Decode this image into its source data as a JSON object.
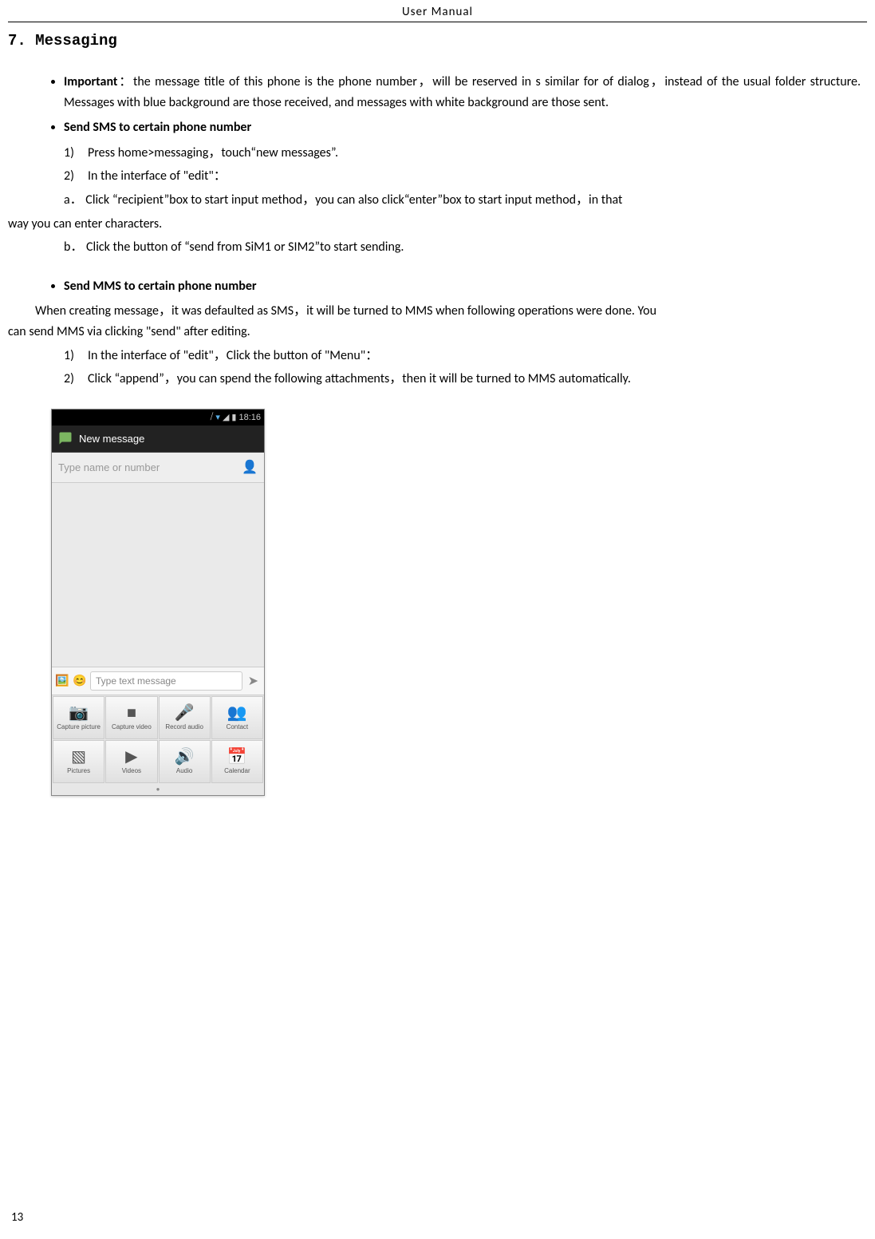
{
  "header": {
    "title": "User    Manual"
  },
  "section": {
    "title": "7. Messaging"
  },
  "bullets": {
    "important_label": "Important",
    "important_text": "：the message title of this phone is the phone number，will be reserved in s similar for of dialog，instead of the usual folder structure. Messages with blue background are those received, and messages with white background are those sent.",
    "send_sms_label": "Send SMS to certain phone number",
    "send_mms_label": "Send MMS to certain phone number"
  },
  "sms_steps": {
    "s1": "Press home>messaging，touch“new messages”.",
    "s2": "In the interface of \"edit\"：",
    "a_pre": "a．   Click  “recipient”box to start input method，you can also click“enter”box to start input method，in that",
    "a_wrap": "way you can enter characters.",
    "b": "b．   Click the button of  “send from SiM1 or SIM2”to start sending."
  },
  "mms_para": {
    "line1": "When creating message，it was defaulted as SMS，it will be turned to MMS when following operations were done. You",
    "line2": "can send MMS via clicking \"send\" after editing."
  },
  "mms_steps": {
    "s1": "In the interface of \"edit\"，Click the button of \"Menu\"：",
    "s2": "Click  “append”，you can spend the following attachments，then it will be turned to MMS automatically."
  },
  "phone": {
    "time": "18:16",
    "title": "New message",
    "recipient_placeholder": "Type name or number",
    "compose_placeholder": "Type text message",
    "attachments": [
      {
        "label": "Capture picture",
        "glyph": "📷"
      },
      {
        "label": "Capture video",
        "glyph": "■"
      },
      {
        "label": "Record audio",
        "glyph": "🎤"
      },
      {
        "label": "Contact",
        "glyph": "👥"
      },
      {
        "label": "Pictures",
        "glyph": "▧"
      },
      {
        "label": "Videos",
        "glyph": "▶"
      },
      {
        "label": "Audio",
        "glyph": "🔊"
      },
      {
        "label": "Calendar",
        "glyph": "📅"
      }
    ]
  },
  "page_number": "13"
}
